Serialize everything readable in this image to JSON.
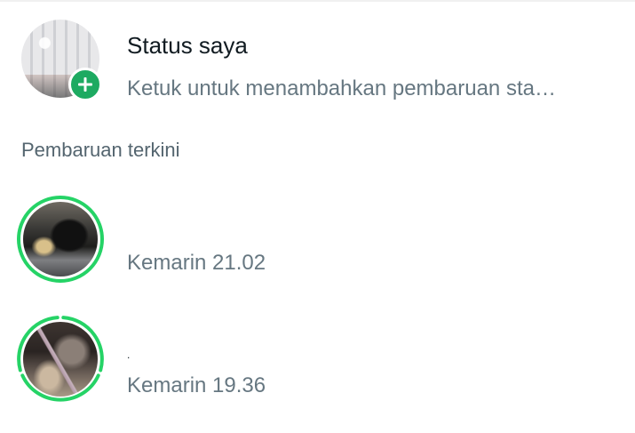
{
  "my_status": {
    "title": "Status saya",
    "subtitle": "Ketuk untuk menambahkan pembaruan sta…",
    "add_icon": "plus-icon"
  },
  "recent_section": {
    "header": "Pembaruan terkini"
  },
  "recent_updates": [
    {
      "name": "",
      "time": "Kemarin 21.02",
      "ring_color": "#25d366",
      "segments": 1
    },
    {
      "name": ".",
      "time": "Kemarin 19.36",
      "ring_color": "#25d366",
      "segments": 3
    }
  ],
  "colors": {
    "accent": "#25d366",
    "badge": "#1daa61",
    "primary_text": "#111b21",
    "secondary_text": "#667781"
  }
}
